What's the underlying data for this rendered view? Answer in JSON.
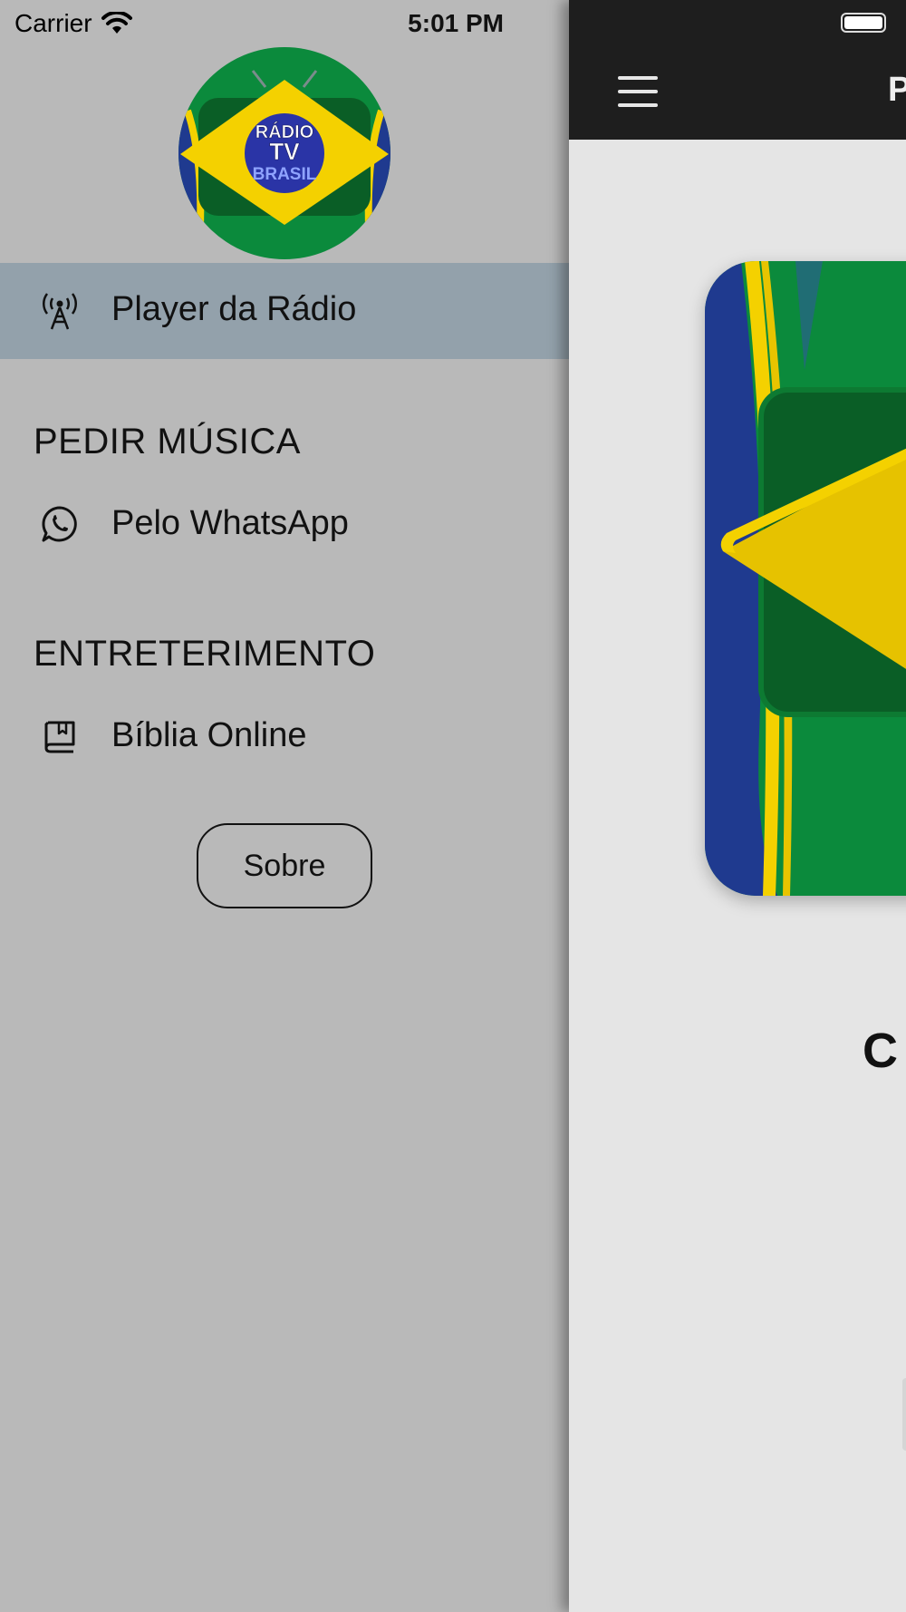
{
  "status_bar": {
    "carrier": "Carrier",
    "time": "5:01 PM"
  },
  "drawer": {
    "logo_text": [
      "RÁDIO",
      "TV",
      "BRASIL"
    ],
    "items": [
      {
        "label": "Player da Rádio",
        "icon": "radio-tower-icon",
        "active": true
      }
    ],
    "sections": [
      {
        "title": "PEDIR MÚSICA",
        "items": [
          {
            "label": "Pelo WhatsApp",
            "icon": "whatsapp-icon"
          }
        ]
      },
      {
        "title": "ENTRETERIMENTO",
        "items": [
          {
            "label": "Bíblia Online",
            "icon": "book-icon"
          }
        ]
      }
    ],
    "about_button": "Sobre"
  },
  "main": {
    "nav_title": "P",
    "now_playing_title": "C"
  },
  "colors": {
    "drawer_bg": "#b9b9b9",
    "active_row_bg": "#93a1ab",
    "navbar_bg": "#1e1e1e",
    "content_bg": "#e5e5e5",
    "brazil_green": "#0a8a3a",
    "brazil_yellow": "#f4d100",
    "brazil_blue": "#1f3a8f"
  }
}
